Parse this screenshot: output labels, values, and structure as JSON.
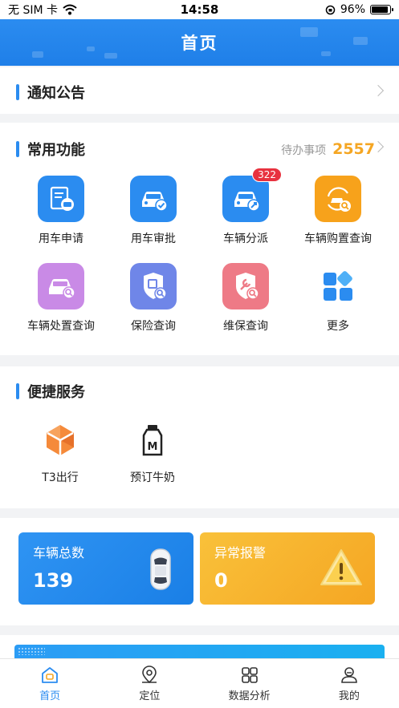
{
  "status_bar": {
    "carrier": "无 SIM 卡",
    "time": "14:58",
    "battery": "96%"
  },
  "header": {
    "title": "首页"
  },
  "notice": {
    "title": "通知公告"
  },
  "functions": {
    "title": "常用功能",
    "todo_label": "待办事项",
    "todo_count": "2557",
    "items": [
      {
        "label": "用车申请",
        "icon": "vehicle-application-icon",
        "color": "#2b8cf0"
      },
      {
        "label": "用车审批",
        "icon": "vehicle-approval-icon",
        "color": "#2b8cf0"
      },
      {
        "label": "车辆分派",
        "icon": "vehicle-dispatch-icon",
        "color": "#2b8cf0",
        "badge": "322"
      },
      {
        "label": "车辆购置查询",
        "icon": "vehicle-purchase-query-icon",
        "color": "#f7a21b"
      },
      {
        "label": "车辆处置查询",
        "icon": "vehicle-disposal-query-icon",
        "color": "#c98ae6"
      },
      {
        "label": "保险查询",
        "icon": "insurance-query-icon",
        "color": "#6f86e8"
      },
      {
        "label": "维保查询",
        "icon": "maintenance-query-icon",
        "color": "#ee7a86"
      },
      {
        "label": "更多",
        "icon": "more-apps-icon",
        "color": "#2b8cf0"
      }
    ]
  },
  "services": {
    "title": "便捷服务",
    "items": [
      {
        "label": "T3出行",
        "icon": "t3-logo-icon"
      },
      {
        "label": "预订牛奶",
        "icon": "milk-bottle-icon",
        "logo_text": "M"
      }
    ]
  },
  "stats": {
    "vehicles": {
      "title": "车辆总数",
      "value": "139",
      "color": "#2b8cf0"
    },
    "alarms": {
      "title": "异常报警",
      "value": "0",
      "color": "#f7b32b"
    }
  },
  "tabs": [
    {
      "label": "首页",
      "icon": "home-icon",
      "active": true
    },
    {
      "label": "定位",
      "icon": "location-icon",
      "active": false
    },
    {
      "label": "数据分析",
      "icon": "data-analysis-icon",
      "active": false
    },
    {
      "label": "我的",
      "icon": "profile-icon",
      "active": false
    }
  ],
  "colors": {
    "primary": "#2b8cf0",
    "accent": "#f5a623",
    "badge": "#e8323f"
  }
}
